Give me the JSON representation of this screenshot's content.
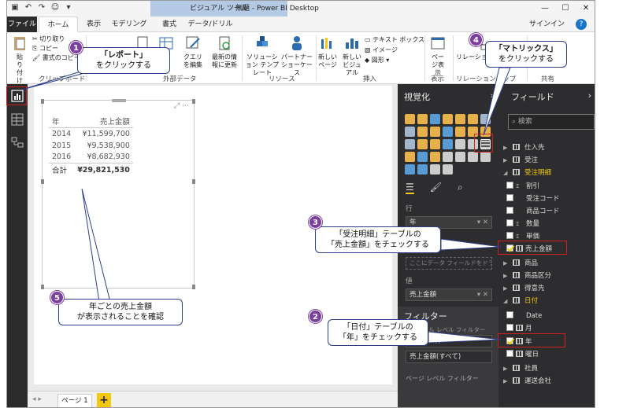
{
  "titlebar": {
    "context_tab": "ビジュアル ツール",
    "app_title": "無題 - Power BI Desktop",
    "signin": "サインイン",
    "help": "?"
  },
  "tabs": {
    "file": "ファイル",
    "home": "ホーム",
    "view": "表示",
    "modeling": "モデリング",
    "format": "書式",
    "data": "データ/ドリル"
  },
  "ribbon": {
    "paste": "貼り付け",
    "cut": "切り取り",
    "copy": "コピー",
    "format_painter": "書式のコピー",
    "clipboard_group": "クリップボード",
    "edit_query": "クエリを編集",
    "refresh": "最新の情報に更新",
    "external_group": "外部データ",
    "solution_template": "ソリューション テンプレート",
    "partner_showcase": "パートナー ショーケース",
    "resources_group": "リソース",
    "new_page": "新しいページ",
    "new_visual": "新しいビジュアル",
    "textbox": "テキスト ボックス",
    "image": "イメージ",
    "shapes": "図形",
    "insert_group": "挿入",
    "page_view": "ページ表示",
    "view_group": "表示",
    "relationships": "リレーションシップの管理",
    "rel_group": "リレーションシップ",
    "share_group": "共有"
  },
  "matrix": {
    "header_year": "年",
    "header_amount": "売上金額",
    "rows": [
      {
        "year": "2014",
        "amount": "¥11,599,700"
      },
      {
        "year": "2015",
        "amount": "¥9,538,900"
      },
      {
        "year": "2016",
        "amount": "¥8,682,930"
      }
    ],
    "total_label": "合計",
    "total_amount": "¥29,821,530"
  },
  "pages": {
    "page1": "ページ 1",
    "add": "+"
  },
  "viz_pane": {
    "title": "視覚化",
    "rows_label": "行",
    "rows_value": "年",
    "columns_hint": "ここにデータ フィールドをドラッグ...",
    "values_label": "値",
    "values_value": "売上金額",
    "filters_title": "フィルター",
    "visual_filter": "ビジュアル レベル フィルター",
    "filter_year": "年(すべて)",
    "filter_amount": "売上金額(すべて)",
    "page_filter": "ページ レベル フィルター"
  },
  "fields_pane": {
    "title": "フィールド",
    "search_placeholder": "検索",
    "tables": {
      "t1": "仕入先",
      "t2": "受注",
      "t3": "受注明細",
      "f1": "割引",
      "f2": "受注コード",
      "f3": "商品コード",
      "f4": "数量",
      "f5": "単価",
      "f6": "売上金額",
      "t4": "商品",
      "t5": "商品区分",
      "t6": "得意先",
      "t7": "日付",
      "g1": "Date",
      "g2": "月",
      "g3": "年",
      "g4": "曜日",
      "t8": "社員",
      "t9": "運送会社"
    }
  },
  "callouts": {
    "c1_num": "1",
    "c1_line1": "「レポート」",
    "c1_line2": "をクリックする",
    "c2_num": "2",
    "c2_line1": "「日付」テーブルの",
    "c2_line2": "「年」をチェックする",
    "c3_num": "3",
    "c3_line1": "「受注明細」テーブルの",
    "c3_line2": "「売上金額」をチェックする",
    "c4_num": "4",
    "c4_line1": "「マトリックス」",
    "c4_line2": "をクリックする",
    "c5_num": "5",
    "c5_line1": "年ごとの売上金額",
    "c5_line2": "が表示されることを確認"
  },
  "colors": {
    "accent": "#f2c811",
    "callout_border": "#2d3f8c",
    "badge": "#7b3fa0",
    "highlight": "#d12020"
  }
}
